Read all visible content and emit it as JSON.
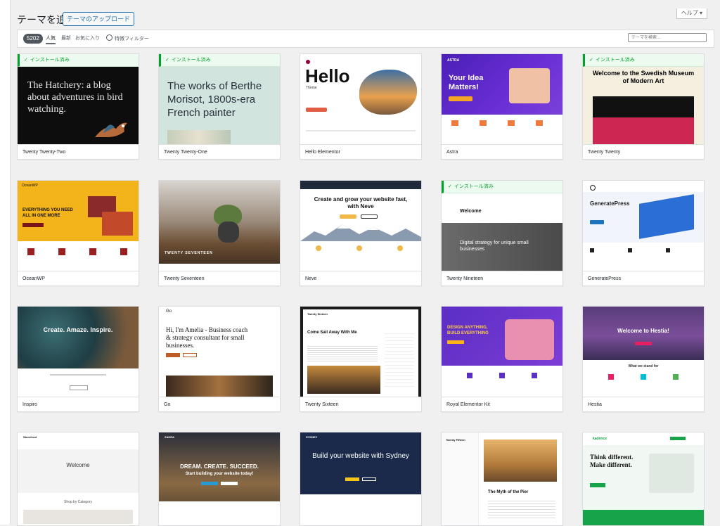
{
  "header": {
    "title": "テーマを追加",
    "upload_label": "テーマのアップロード",
    "help_label": "ヘルプ ▾"
  },
  "filter": {
    "count": "5202",
    "tabs": [
      "人気",
      "最新",
      "お気に入り"
    ],
    "feature_filter": "特徴フィルター",
    "search_placeholder": "テーマを検索..."
  },
  "installed_label": "インストール済み",
  "themes": [
    {
      "name": "Twenty Twenty-Two",
      "installed": true
    },
    {
      "name": "Twenty Twenty-One",
      "installed": true
    },
    {
      "name": "Hello Elementor",
      "installed": false
    },
    {
      "name": "Astra",
      "installed": false
    },
    {
      "name": "Twenty Twenty",
      "installed": true
    },
    {
      "name": "OceanWP",
      "installed": false
    },
    {
      "name": "Twenty Seventeen",
      "installed": false
    },
    {
      "name": "Neve",
      "installed": false
    },
    {
      "name": "Twenty Nineteen",
      "installed": true
    },
    {
      "name": "GeneratePress",
      "installed": false
    },
    {
      "name": "Inspiro",
      "installed": false
    },
    {
      "name": "Go",
      "installed": false
    },
    {
      "name": "Twenty Sixteen",
      "installed": false
    },
    {
      "name": "Royal Elementor Kit",
      "installed": false
    },
    {
      "name": "Hestia",
      "installed": false
    },
    {
      "name": "Storefront",
      "installed": false
    },
    {
      "name": "Zakra",
      "installed": false
    },
    {
      "name": "Sydney",
      "installed": false
    },
    {
      "name": "Twenty Fifteen",
      "installed": false
    },
    {
      "name": "Kadence",
      "installed": false
    }
  ],
  "previews": {
    "t1": "The Hatchery: a blog about adventures in bird watching.",
    "t2": "The works of Berthe Morisot, 1800s-era French painter",
    "t3_title": "Hello",
    "t3_sub": "Theme",
    "t4_title": "Your Idea Matters!",
    "t4_brand": "ASTRA",
    "t5_title": "Welcome to the Swedish Museum of Modern Art",
    "t6_title": "EVERYTHING YOU NEED ALL IN ONE MORE",
    "t6_brand": "OceanWP",
    "t7_title": "TWENTY SEVENTEEN",
    "t8_title": "Create and grow your website fast, with Neve",
    "t9_welcome": "Welcome",
    "t9_title": "Digital strategy for unique small businesses",
    "t10_title": "GeneratePress",
    "t11_title": "Create. Amaze. Inspire.",
    "t12_brand": "Go",
    "t12_title": "Hi, I'm Amelia - Business coach & strategy consultant for small businesses.",
    "t13_brand": "Twenty Sixteen",
    "t13_title": "Come Sail Away With Me",
    "t14_title": "DESIGN ANYTHING, BUILD EVERYTHING",
    "t15_title": "Welcome to Hestia!",
    "t15_sub": "What we stand for",
    "t16_brand": "Storefront",
    "t16_title": "Welcome",
    "t16_sub": "Shop by Category",
    "t17_brand": "ZAKRA",
    "t17_title": "DREAM. CREATE. SUCCEED.",
    "t17_sub": "Start building your website today!",
    "t18_brand": "SYDNEY",
    "t18_title": "Build your website with Sydney",
    "t19_brand": "Twenty Fifteen",
    "t19_title": "The Myth of the Pier",
    "t20_brand": "kadence",
    "t20_title": "Think different. Make different."
  }
}
